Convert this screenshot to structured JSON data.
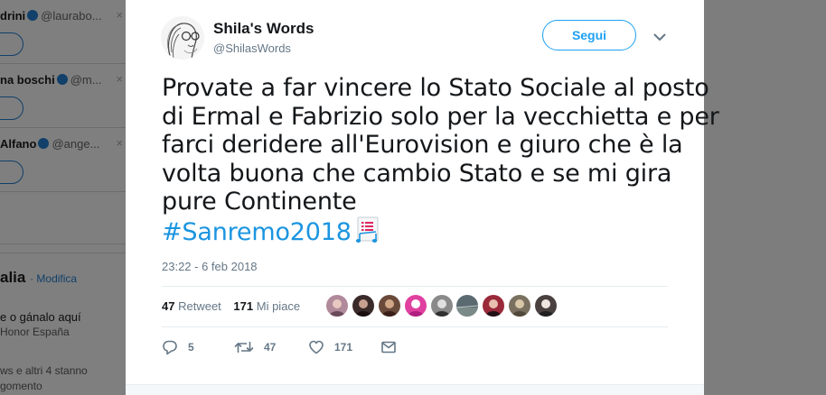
{
  "background": {
    "who_to_follow": [
      {
        "name": "drini",
        "handle": "@laurabo...",
        "dismiss": "×"
      },
      {
        "name": "na boschi",
        "handle": "@m...",
        "dismiss": "×"
      },
      {
        "name": "Alfano",
        "handle": "@ange...",
        "dismiss": "×"
      }
    ],
    "trends": {
      "title": "alia",
      "edit_label": "· Modifica",
      "promo_line": "e o gánalo aquí",
      "promo_by": "Honor España",
      "more_line": "ws e altri 4 stanno",
      "more_line2": "gomento"
    }
  },
  "tweet": {
    "author": {
      "name": "Shila's Words",
      "handle": "@ShilasWords"
    },
    "follow_label": "Segui",
    "text_lines": [
      "Provate a far vincere lo Stato Sociale al posto",
      "di Ermal e Fabrizio solo per la vecchietta e per",
      "farci deridere all'Eurovision e giuro che è la",
      "volta buona che cambio Stato e se mi gira",
      "pure Continente"
    ],
    "hashtag": "#Sanremo2018",
    "timestamp": "23:22 - 6 feb 2018",
    "stats": {
      "retweets": "47",
      "retweets_label": "Retweet",
      "likes": "171",
      "likes_label": "Mi piace"
    },
    "likers": [
      {
        "icon": "liker-avatar-1",
        "color": "#b08a9a"
      },
      {
        "icon": "liker-avatar-2",
        "color": "#3a2a2a"
      },
      {
        "icon": "liker-avatar-3",
        "color": "#6a4a3a"
      },
      {
        "icon": "liker-avatar-4",
        "color": "#e040a0"
      },
      {
        "icon": "liker-avatar-5",
        "color": "#8a8a8a"
      },
      {
        "icon": "liker-avatar-6",
        "color": "#5a6a70"
      },
      {
        "icon": "liker-avatar-7",
        "color": "#9a2a3a"
      },
      {
        "icon": "liker-avatar-8",
        "color": "#7a7060"
      },
      {
        "icon": "liker-avatar-9",
        "color": "#4a4040"
      }
    ],
    "actions": {
      "reply_count": "5",
      "retweet_count": "47",
      "like_count": "171"
    }
  },
  "colors": {
    "accent": "#1da1f2",
    "hashtag": "#1b95e0",
    "muted": "#657786",
    "text": "#14171a",
    "overlay": "#7f7f7f"
  }
}
